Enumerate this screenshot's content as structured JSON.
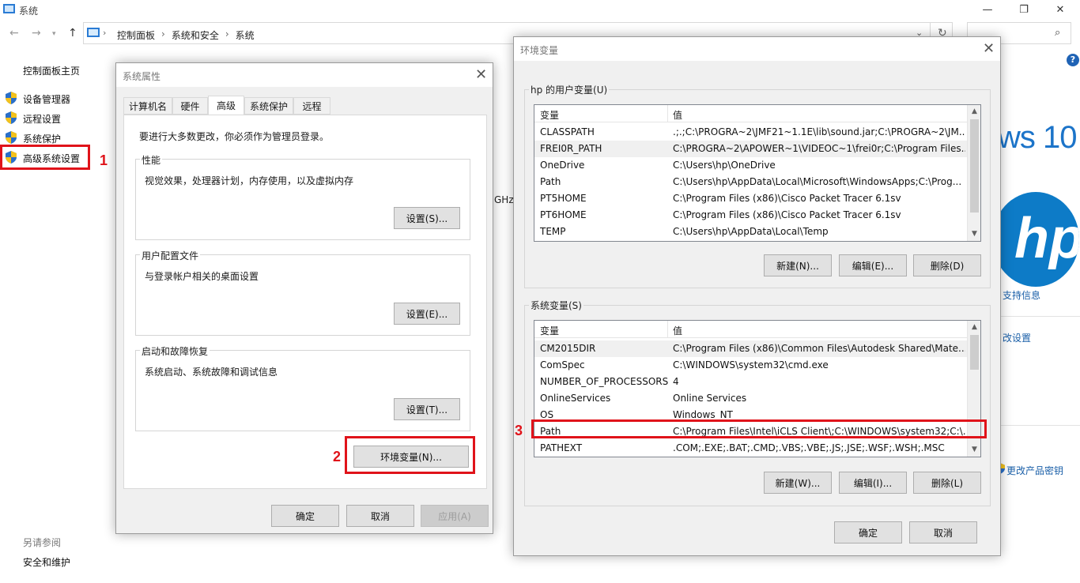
{
  "window": {
    "title": "系统",
    "controls": {
      "minimize": "—",
      "maximize": "❐",
      "close": "✕"
    }
  },
  "address": {
    "breadcrumb": [
      "控制面板",
      "系统和安全",
      "系统"
    ],
    "separator": "›"
  },
  "left_pane": {
    "home": "控制面板主页",
    "links": [
      "设备管理器",
      "远程设置",
      "系统保护",
      "高级系统设置"
    ],
    "see_also_title": "另请参阅",
    "see_also": [
      "安全和维护"
    ]
  },
  "background": {
    "ghz_fragment": "GHz",
    "windows_logo_text": "ws 10",
    "hp_logo_text": "hp",
    "support_link": "支持信息",
    "change_settings_link": "改设置",
    "product_key_link": "更改产品密钥"
  },
  "system_properties": {
    "title": "系统属性",
    "tabs": [
      "计算机名",
      "硬件",
      "高级",
      "系统保护",
      "远程"
    ],
    "active_tab": "高级",
    "admin_note": "要进行大多数更改，你必须作为管理员登录。",
    "groups": [
      {
        "label": "性能",
        "desc": "视觉效果，处理器计划，内存使用，以及虚拟内存",
        "button": "设置(S)..."
      },
      {
        "label": "用户配置文件",
        "desc": "与登录帐户相关的桌面设置",
        "button": "设置(E)..."
      },
      {
        "label": "启动和故障恢复",
        "desc": "系统启动、系统故障和调试信息",
        "button": "设置(T)..."
      }
    ],
    "env_button": "环境变量(N)...",
    "ok": "确定",
    "cancel": "取消",
    "apply": "应用(A)"
  },
  "env_vars": {
    "title": "环境变量",
    "user_section": "hp 的用户变量(U)",
    "system_section": "系统变量(S)",
    "col_name": "变量",
    "col_value": "值",
    "user_vars": [
      {
        "name": "CLASSPATH",
        "value": ".;.;C:\\PROGRA~2\\JMF21~1.1E\\lib\\sound.jar;C:\\PROGRA~2\\JM..."
      },
      {
        "name": "FREI0R_PATH",
        "value": "C:\\PROGRA~2\\APOWER~1\\VIDEOC~1\\frei0r;C:\\Program Files..."
      },
      {
        "name": "OneDrive",
        "value": "C:\\Users\\hp\\OneDrive"
      },
      {
        "name": "Path",
        "value": "C:\\Users\\hp\\AppData\\Local\\Microsoft\\WindowsApps;C:\\Prog..."
      },
      {
        "name": "PT5HOME",
        "value": "C:\\Program Files (x86)\\Cisco Packet Tracer 6.1sv"
      },
      {
        "name": "PT6HOME",
        "value": "C:\\Program Files (x86)\\Cisco Packet Tracer 6.1sv"
      },
      {
        "name": "TEMP",
        "value": "C:\\Users\\hp\\AppData\\Local\\Temp"
      }
    ],
    "system_vars": [
      {
        "name": "CM2015DIR",
        "value": "C:\\Program Files (x86)\\Common Files\\Autodesk Shared\\Mate..."
      },
      {
        "name": "ComSpec",
        "value": "C:\\WINDOWS\\system32\\cmd.exe"
      },
      {
        "name": "NUMBER_OF_PROCESSORS",
        "value": "4"
      },
      {
        "name": "OnlineServices",
        "value": "Online Services"
      },
      {
        "name": "OS",
        "value": "Windows_NT"
      },
      {
        "name": "Path",
        "value": "C:\\Program Files\\Intel\\iCLS Client\\;C:\\WINDOWS\\system32;C:\\..."
      },
      {
        "name": "PATHEXT",
        "value": ".COM;.EXE;.BAT;.CMD;.VBS;.VBE;.JS;.JSE;.WSF;.WSH;.MSC"
      }
    ],
    "user_buttons": [
      "新建(N)...",
      "编辑(E)...",
      "删除(D)"
    ],
    "system_buttons": [
      "新建(W)...",
      "编辑(I)...",
      "删除(L)"
    ],
    "ok": "确定",
    "cancel": "取消"
  },
  "annotations": [
    "1",
    "2",
    "3"
  ],
  "colors": {
    "highlight": "#e0131a",
    "link": "#1a5fa8",
    "win_blue": "#1c74c9"
  }
}
